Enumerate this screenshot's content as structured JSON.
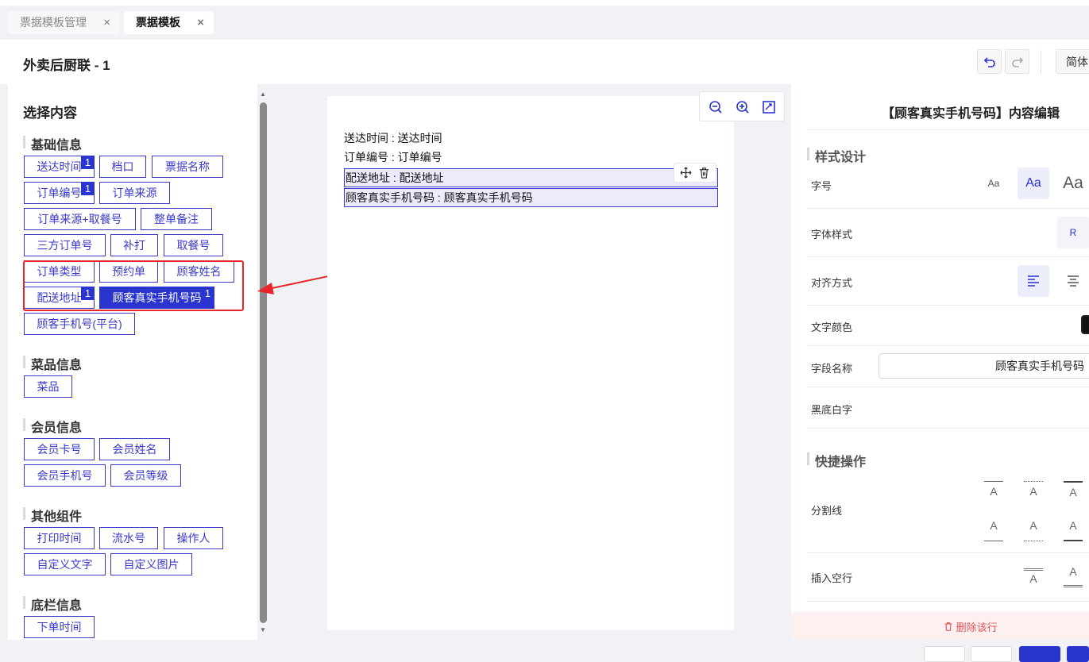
{
  "tabs": [
    {
      "label": "票据模板管理"
    },
    {
      "label": "票据模板"
    }
  ],
  "close_glyph": "×",
  "header": {
    "title": "外卖后厨联 - 1",
    "lang_label": "简体"
  },
  "left": {
    "title": "选择内容",
    "sections": {
      "basic": {
        "title": "基础信息",
        "items": {
          "delivery_time": "送达时间",
          "stall": "档口",
          "ticket_name": "票据名称",
          "order_no": "订单编号",
          "order_source": "订单来源",
          "order_source_pickup": "订单来源+取餐号",
          "order_remark": "整单备注",
          "third_order": "三方订单号",
          "reprint": "补打",
          "pickup_no": "取餐号",
          "order_type": "订单类型",
          "reservation": "预约单",
          "customer_name": "顾客姓名",
          "delivery_addr": "配送地址",
          "real_phone": "顾客真实手机号码",
          "platform_phone": "顾客手机号(平台)"
        }
      },
      "dish": {
        "title": "菜品信息",
        "items": {
          "dish": "菜品"
        }
      },
      "member": {
        "title": "会员信息",
        "items": {
          "card": "会员卡号",
          "name": "会员姓名",
          "phone": "会员手机号",
          "level": "会员等级"
        }
      },
      "other": {
        "title": "其他组件",
        "items": {
          "print_time": "打印时间",
          "serial": "流水号",
          "operator": "操作人",
          "custom_text": "自定义文字",
          "custom_image": "自定义图片"
        }
      },
      "footer": {
        "title": "底栏信息",
        "items": {
          "order_time": "下单时间"
        }
      }
    },
    "badge": "1"
  },
  "preview": {
    "lines": [
      "送达时间 : 送达时间",
      "订单编号 : 订单编号",
      "配送地址 : 配送地址",
      "顾客真实手机号码 : 顾客真实手机号码"
    ]
  },
  "right": {
    "title": "【顾客真实手机号码】内容编辑",
    "style_section": "样式设计",
    "font_size_label": "字号",
    "font_sizes": [
      "Aa",
      "Aa",
      "Aa"
    ],
    "font_style_label": "字体样式",
    "font_style_r": "R",
    "align_label": "对齐方式",
    "color_label": "文字颜色",
    "field_name_label": "字段名称",
    "field_name_value": "顾客真实手机号码",
    "inverse_label": "黑底白字",
    "quick_section": "快捷操作",
    "divider_label": "分割线",
    "divider_glyph": "A",
    "blank_line_label": "插入空行",
    "delete_row": "删除该行"
  },
  "colors": {
    "accent": "#2a34cf",
    "danger": "#e8272a"
  }
}
